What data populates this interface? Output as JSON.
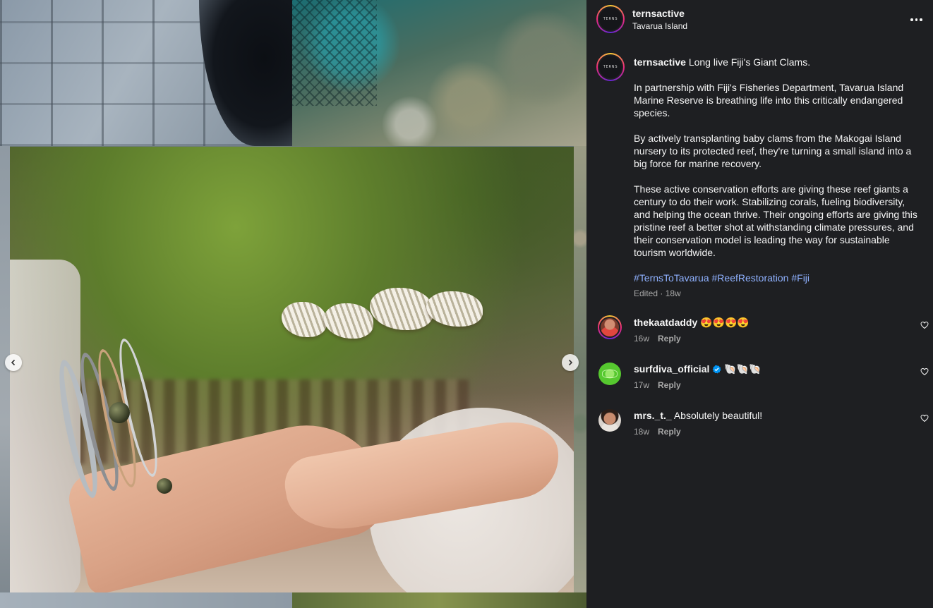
{
  "post": {
    "username": "ternsactive",
    "location": "Tavarua Island",
    "avatar_text": "TERNS",
    "more_icon": "more-horizontal-icon"
  },
  "caption": {
    "username": "ternsactive",
    "text_lead": " Long live Fiji's Giant Clams.",
    "paragraphs": [
      "In partnership with Fiji's Fisheries Department, Tavarua Island Marine Reserve is breathing life into this critically endangered species.",
      "By actively transplanting baby clams from the Makogai Island nursery to its protected reef, they're turning a small island into a big force for marine recovery.",
      "These active conservation efforts are giving these reef giants a century to do their work. Stabilizing corals, fueling biodiversity, and helping the ocean thrive. Their ongoing efforts are giving this pristine reef a better shot at withstanding climate pressures, and their conservation model is leading the way for sustainable tourism worldwide."
    ],
    "hashtags": [
      "#TernsToTavarua",
      "#ReefRestoration",
      "#Fiji"
    ],
    "edited_label": "Edited",
    "separator": " · ",
    "time": "18w"
  },
  "comments": [
    {
      "username": "thekaatdaddy",
      "text": " 😍😍😍😍",
      "time": "16w",
      "reply_label": "Reply",
      "verified": false
    },
    {
      "username": "surfdiva_official",
      "text": " 🐚🐚🐚",
      "time": "17w",
      "reply_label": "Reply",
      "verified": true
    },
    {
      "username": "mrs._t._",
      "text": " Absolutely beautiful!",
      "time": "18w",
      "reply_label": "Reply",
      "verified": false
    }
  ],
  "colors": {
    "panel_bg": "#1e1f22",
    "text": "#f5f5f5",
    "muted": "#a8a8a8",
    "hashtag": "#8fb1ff",
    "verified": "#0095f6"
  },
  "carousel": {
    "prev_icon": "chevron-left-icon",
    "next_icon": "chevron-right-icon"
  }
}
